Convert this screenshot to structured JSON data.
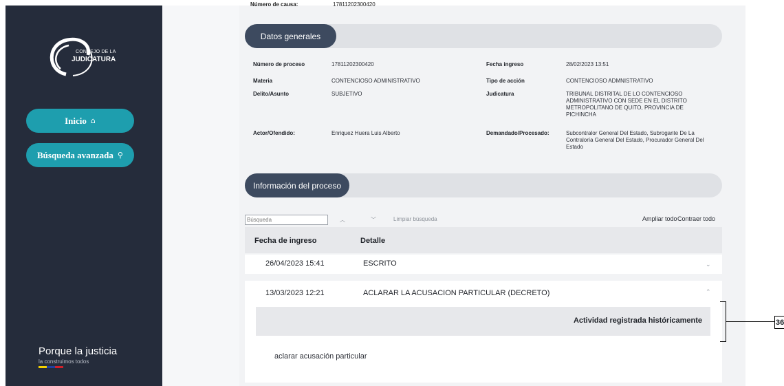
{
  "sidebar": {
    "logo_line1": "CONSEJO DE LA",
    "logo_line2": "JUDICATURA",
    "nav": [
      {
        "label": "Inicio",
        "icon": "home-icon"
      },
      {
        "label": "Búsqueda avanzada",
        "icon": "search-icon"
      }
    ],
    "slogan_line1": "Porque la justicia",
    "slogan_line2": "la construimos todos",
    "flag_colors": [
      "#f4d000",
      "#1f3fa0",
      "#d0202a"
    ]
  },
  "top_cut": {
    "label": "Número de causa:",
    "value": "17811202300420"
  },
  "datos_generales": {
    "title": "Datos generales",
    "fields": [
      {
        "label": "Número de proceso",
        "value": "17811202300420"
      },
      {
        "label": "Fecha ingreso",
        "value": "28/02/2023 13:51"
      },
      {
        "label": "Materia",
        "value": "CONTENCIOSO ADMINISTRATIVO"
      },
      {
        "label": "Tipo de acción",
        "value": "CONTENCIOSO ADMNISTRATIVO"
      },
      {
        "label": "Delito/Asunto",
        "value": "SUBJETIVO"
      },
      {
        "label": "Judicatura",
        "value": "TRIBUNAL DISTRITAL DE LO CONTENCIOSO ADMINISTRATIVO CON SEDE EN EL DISTRITO METROPOLITANO DE QUITO, PROVINCIA DE PICHINCHA"
      },
      {
        "label": "Actor/Ofendido:",
        "value": "Enriquez Huera Luis Alberto"
      },
      {
        "label": "Demandado/Procesado:",
        "value": "Subcontralor General Del Estado, Subrogante De La Contraloría General Del Estado, Procurador General Del Estado"
      }
    ]
  },
  "info_proceso": {
    "title": "Información del proceso",
    "search_placeholder": "Búsqueda",
    "up_icon": "chevron-up-icon",
    "down_icon": "chevron-down-icon",
    "clear_label": "Limpiar búsqueda",
    "expand_all": "Ampliar todo",
    "collapse_all": "Contraer todo",
    "columns": [
      "Fecha de ingreso",
      "Detalle"
    ],
    "rows": [
      {
        "fecha": "26/04/2023 15:41",
        "detalle": "ESCRITO",
        "expanded": false
      },
      {
        "fecha": "13/03/2023 12:21",
        "detalle": "ACLARAR LA ACUSACION PARTICULAR (DECRETO)",
        "expanded": true
      }
    ],
    "historic_label": "Actividad registrada históricamente",
    "description": "aclarar acusación particular"
  },
  "callout": {
    "number": "36"
  }
}
